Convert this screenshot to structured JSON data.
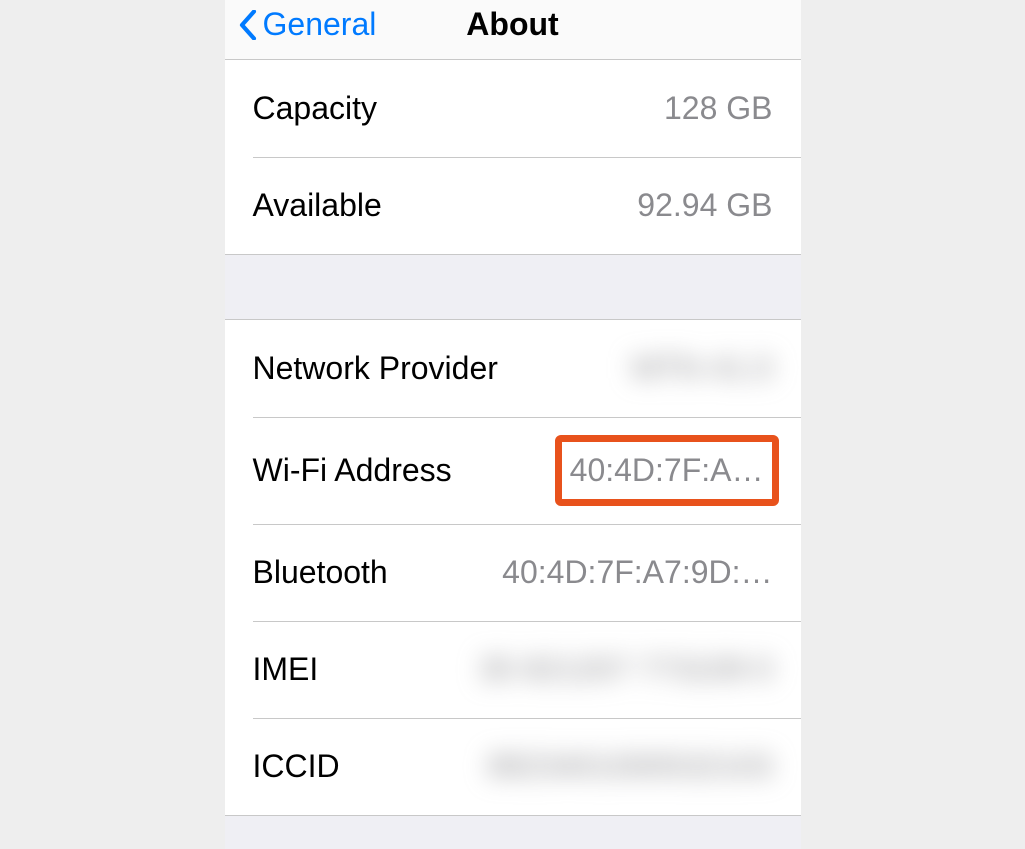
{
  "nav": {
    "back_label": "General",
    "title": "About"
  },
  "group1": [
    {
      "label": "Capacity",
      "value": "128 GB"
    },
    {
      "label": "Available",
      "value": "92.94 GB"
    }
  ],
  "group2": [
    {
      "label": "Network Provider",
      "value": "MTN 41.0",
      "redacted": true
    },
    {
      "label": "Wi-Fi Address",
      "value": "40:4D:7F:A…",
      "highlight": true
    },
    {
      "label": "Bluetooth",
      "value": "40:4D:7F:A7:9D:…"
    },
    {
      "label": "IMEI",
      "value": "35 821207 773109 0",
      "redacted": true
    },
    {
      "label": "ICCID",
      "value": "8923401000532103",
      "redacted": true
    }
  ]
}
